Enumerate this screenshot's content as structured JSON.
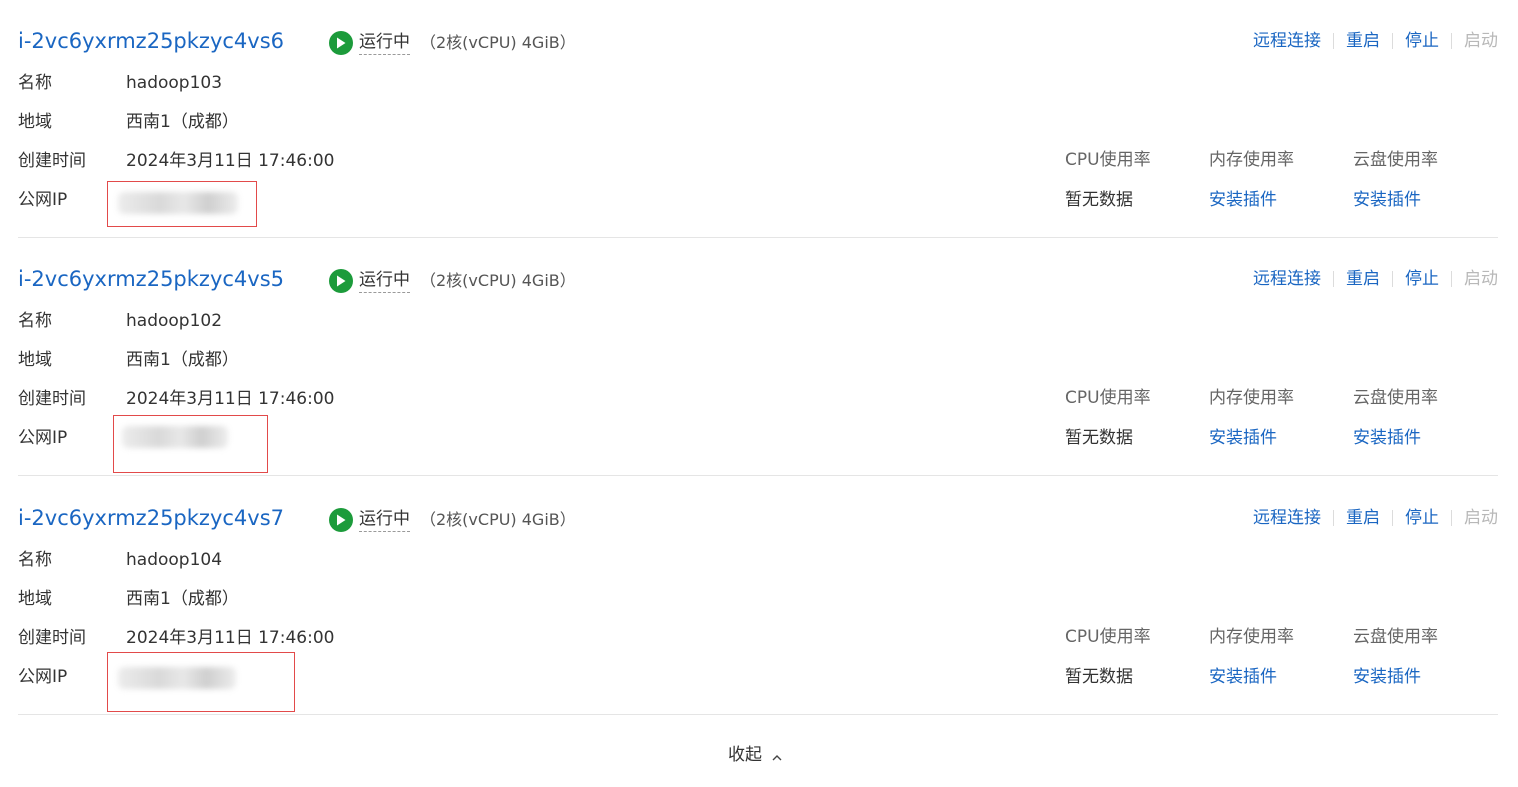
{
  "instances": [
    {
      "id": "i-2vc6yxrmz25pkzyc4vs6",
      "status": "运行中",
      "spec": "（2核(vCPU) 4GiB）",
      "name_label": "名称",
      "name": "hadoop103",
      "region_label": "地域",
      "region": "西南1（成都）",
      "created_label": "创建时间",
      "created": "2024年3月11日 17:46:00",
      "ip_label": "公网IP",
      "actions": [
        "远程连接",
        "重启",
        "停止",
        "启动"
      ],
      "monitor_headers": [
        "CPU使用率",
        "内存使用率",
        "云盘使用率"
      ],
      "monitor_values": [
        "暂无数据",
        "安装插件",
        "安装插件"
      ]
    },
    {
      "id": "i-2vc6yxrmz25pkzyc4vs5",
      "status": "运行中",
      "spec": "（2核(vCPU) 4GiB）",
      "name_label": "名称",
      "name": "hadoop102",
      "region_label": "地域",
      "region": "西南1（成都）",
      "created_label": "创建时间",
      "created": "2024年3月11日 17:46:00",
      "ip_label": "公网IP",
      "actions": [
        "远程连接",
        "重启",
        "停止",
        "启动"
      ],
      "monitor_headers": [
        "CPU使用率",
        "内存使用率",
        "云盘使用率"
      ],
      "monitor_values": [
        "暂无数据",
        "安装插件",
        "安装插件"
      ]
    },
    {
      "id": "i-2vc6yxrmz25pkzyc4vs7",
      "status": "运行中",
      "spec": "（2核(vCPU) 4GiB）",
      "name_label": "名称",
      "name": "hadoop104",
      "region_label": "地域",
      "region": "西南1（成都）",
      "created_label": "创建时间",
      "created": "2024年3月11日 17:46:00",
      "ip_label": "公网IP",
      "actions": [
        "远程连接",
        "重启",
        "停止",
        "启动"
      ],
      "monitor_headers": [
        "CPU使用率",
        "内存使用率",
        "云盘使用率"
      ],
      "monitor_values": [
        "暂无数据",
        "安装插件",
        "安装插件"
      ]
    }
  ],
  "footer": {
    "collapse_label": "收起"
  },
  "colors": {
    "link": "#1a66c2",
    "running": "#1c9b3b",
    "disabled": "#b8b8b8",
    "highlight_box": "#e24a4a",
    "divider": "#e5e5e5"
  },
  "icons": {
    "status": "play-circle-icon",
    "collapse": "chevron-up-icon"
  }
}
